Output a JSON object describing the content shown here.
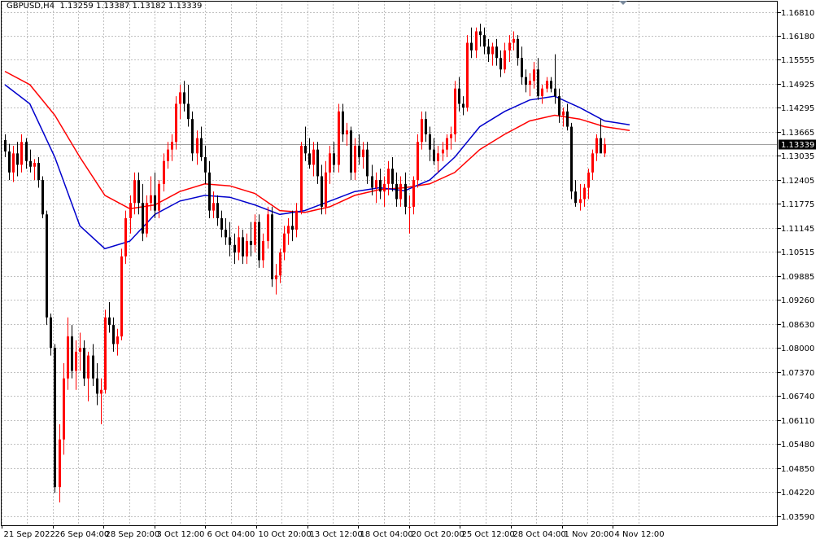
{
  "header": {
    "symbol": "GBPUSD,H4",
    "ohlc": "1.13259 1.13387 1.13182 1.13339"
  },
  "colors": {
    "bull": "#ff0000",
    "bear": "#000000",
    "ma_fast": "#0000cc",
    "ma_slow": "#ff0000",
    "grid": "#c0c0c0",
    "price_box": "#000000"
  },
  "chart_data": {
    "type": "candlestick",
    "ylim": [
      1.0335,
      1.171
    ],
    "grid": true,
    "current_price": "1.13339",
    "price_ticks": [
      "1.16810",
      "1.16180",
      "1.15555",
      "1.14925",
      "1.14295",
      "1.13665",
      "1.13035",
      "1.12405",
      "1.11775",
      "1.11145",
      "1.10515",
      "1.09885",
      "1.09260",
      "1.08630",
      "1.08000",
      "1.07370",
      "1.06740",
      "1.06110",
      "1.05480",
      "1.04850",
      "1.04220",
      "1.03590"
    ],
    "time_labels": [
      "21 Sep 2022",
      "26 Sep 04:00",
      "28 Sep 20:00",
      "3 Oct 12:00",
      "6 Oct 04:00",
      "10 Oct 20:00",
      "13 Oct 12:00",
      "18 Oct 04:00",
      "20 Oct 20:00",
      "25 Oct 12:00",
      "28 Oct 04:00",
      "1 Nov 20:00",
      "4 Nov 12:00"
    ],
    "candles": [
      [
        1.1345,
        1.136,
        1.13,
        1.1315
      ],
      [
        1.1315,
        1.1335,
        1.124,
        1.126
      ],
      [
        1.126,
        1.133,
        1.1235,
        1.131
      ],
      [
        1.131,
        1.134,
        1.125,
        1.128
      ],
      [
        1.128,
        1.136,
        1.126,
        1.134
      ],
      [
        1.134,
        1.135,
        1.127,
        1.129
      ],
      [
        1.129,
        1.132,
        1.126,
        1.1275
      ],
      [
        1.1275,
        1.1295,
        1.124,
        1.1285
      ],
      [
        1.1285,
        1.13,
        1.122,
        1.124
      ],
      [
        1.124,
        1.125,
        1.114,
        1.115
      ],
      [
        1.115,
        1.116,
        1.086,
        1.088
      ],
      [
        1.088,
        1.089,
        1.078,
        1.08
      ],
      [
        1.08,
        1.081,
        1.042,
        1.0435
      ],
      [
        1.0435,
        1.06,
        1.0395,
        1.056
      ],
      [
        1.056,
        1.076,
        1.052,
        1.072
      ],
      [
        1.072,
        1.088,
        1.069,
        1.083
      ],
      [
        1.083,
        1.086,
        1.072,
        1.074
      ],
      [
        1.074,
        1.082,
        1.069,
        1.079
      ],
      [
        1.079,
        1.084,
        1.074,
        1.08
      ],
      [
        1.08,
        1.082,
        1.07,
        1.072
      ],
      [
        1.072,
        1.079,
        1.066,
        1.078
      ],
      [
        1.078,
        1.081,
        1.07,
        1.072
      ],
      [
        1.072,
        1.076,
        1.065,
        1.068
      ],
      [
        1.068,
        1.072,
        1.06,
        1.069
      ],
      [
        1.069,
        1.09,
        1.068,
        1.088
      ],
      [
        1.088,
        1.092,
        1.084,
        1.086
      ],
      [
        1.086,
        1.088,
        1.079,
        1.081
      ],
      [
        1.081,
        1.085,
        1.078,
        1.083
      ],
      [
        1.083,
        1.106,
        1.082,
        1.104
      ],
      [
        1.104,
        1.116,
        1.102,
        1.114
      ],
      [
        1.114,
        1.12,
        1.11,
        1.118
      ],
      [
        1.118,
        1.126,
        1.115,
        1.124
      ],
      [
        1.124,
        1.126,
        1.115,
        1.118
      ],
      [
        1.118,
        1.123,
        1.108,
        1.11
      ],
      [
        1.11,
        1.12,
        1.109,
        1.118
      ],
      [
        1.118,
        1.125,
        1.116,
        1.12
      ],
      [
        1.12,
        1.126,
        1.114,
        1.116
      ],
      [
        1.116,
        1.124,
        1.114,
        1.123
      ],
      [
        1.123,
        1.131,
        1.121,
        1.129
      ],
      [
        1.129,
        1.134,
        1.127,
        1.132
      ],
      [
        1.132,
        1.136,
        1.129,
        1.134
      ],
      [
        1.134,
        1.146,
        1.132,
        1.144
      ],
      [
        1.144,
        1.149,
        1.14,
        1.147
      ],
      [
        1.147,
        1.15,
        1.142,
        1.144
      ],
      [
        1.144,
        1.149,
        1.138,
        1.14
      ],
      [
        1.14,
        1.142,
        1.129,
        1.131
      ],
      [
        1.131,
        1.137,
        1.128,
        1.135
      ],
      [
        1.135,
        1.138,
        1.129,
        1.13
      ],
      [
        1.13,
        1.133,
        1.123,
        1.126
      ],
      [
        1.126,
        1.129,
        1.114,
        1.116
      ],
      [
        1.116,
        1.121,
        1.114,
        1.118
      ],
      [
        1.118,
        1.12,
        1.112,
        1.114
      ],
      [
        1.114,
        1.116,
        1.109,
        1.111
      ],
      [
        1.111,
        1.114,
        1.107,
        1.109
      ],
      [
        1.109,
        1.113,
        1.104,
        1.107
      ],
      [
        1.107,
        1.11,
        1.102,
        1.105
      ],
      [
        1.105,
        1.112,
        1.103,
        1.109
      ],
      [
        1.109,
        1.111,
        1.102,
        1.104
      ],
      [
        1.104,
        1.11,
        1.102,
        1.108
      ],
      [
        1.108,
        1.113,
        1.104,
        1.107
      ],
      [
        1.107,
        1.115,
        1.105,
        1.113
      ],
      [
        1.113,
        1.115,
        1.101,
        1.103
      ],
      [
        1.103,
        1.11,
        1.101,
        1.108
      ],
      [
        1.108,
        1.117,
        1.106,
        1.115
      ],
      [
        1.115,
        1.117,
        1.096,
        1.098
      ],
      [
        1.098,
        1.102,
        1.094,
        1.099
      ],
      [
        1.099,
        1.106,
        1.097,
        1.105
      ],
      [
        1.105,
        1.112,
        1.103,
        1.11
      ],
      [
        1.11,
        1.114,
        1.107,
        1.112
      ],
      [
        1.112,
        1.116,
        1.108,
        1.111
      ],
      [
        1.111,
        1.118,
        1.109,
        1.116
      ],
      [
        1.116,
        1.134,
        1.115,
        1.133
      ],
      [
        1.133,
        1.138,
        1.129,
        1.131
      ],
      [
        1.131,
        1.135,
        1.127,
        1.128
      ],
      [
        1.128,
        1.134,
        1.125,
        1.132
      ],
      [
        1.132,
        1.134,
        1.123,
        1.125
      ],
      [
        1.125,
        1.128,
        1.115,
        1.117
      ],
      [
        1.117,
        1.129,
        1.115,
        1.126
      ],
      [
        1.126,
        1.133,
        1.123,
        1.131
      ],
      [
        1.131,
        1.134,
        1.126,
        1.128
      ],
      [
        1.128,
        1.144,
        1.126,
        1.142
      ],
      [
        1.142,
        1.144,
        1.134,
        1.136
      ],
      [
        1.136,
        1.139,
        1.133,
        1.137
      ],
      [
        1.137,
        1.138,
        1.124,
        1.126
      ],
      [
        1.126,
        1.135,
        1.124,
        1.133
      ],
      [
        1.133,
        1.136,
        1.128,
        1.13
      ],
      [
        1.13,
        1.134,
        1.127,
        1.132
      ],
      [
        1.132,
        1.134,
        1.123,
        1.125
      ],
      [
        1.125,
        1.128,
        1.12,
        1.122
      ],
      [
        1.122,
        1.126,
        1.118,
        1.124
      ],
      [
        1.124,
        1.127,
        1.119,
        1.121
      ],
      [
        1.121,
        1.125,
        1.117,
        1.123
      ],
      [
        1.123,
        1.129,
        1.12,
        1.127
      ],
      [
        1.127,
        1.13,
        1.121,
        1.123
      ],
      [
        1.123,
        1.126,
        1.117,
        1.119
      ],
      [
        1.119,
        1.125,
        1.117,
        1.123
      ],
      [
        1.123,
        1.126,
        1.115,
        1.117
      ],
      [
        1.117,
        1.12,
        1.11,
        1.117
      ],
      [
        1.117,
        1.125,
        1.115,
        1.124
      ],
      [
        1.124,
        1.136,
        1.122,
        1.134
      ],
      [
        1.134,
        1.142,
        1.132,
        1.14
      ],
      [
        1.14,
        1.142,
        1.134,
        1.136
      ],
      [
        1.136,
        1.138,
        1.129,
        1.132
      ],
      [
        1.132,
        1.135,
        1.128,
        1.129
      ],
      [
        1.129,
        1.133,
        1.126,
        1.131
      ],
      [
        1.131,
        1.134,
        1.129,
        1.132
      ],
      [
        1.132,
        1.136,
        1.13,
        1.135
      ],
      [
        1.135,
        1.138,
        1.132,
        1.136
      ],
      [
        1.136,
        1.15,
        1.134,
        1.148
      ],
      [
        1.148,
        1.151,
        1.142,
        1.144
      ],
      [
        1.144,
        1.146,
        1.141,
        1.143
      ],
      [
        1.143,
        1.162,
        1.142,
        1.16
      ],
      [
        1.16,
        1.164,
        1.156,
        1.158
      ],
      [
        1.158,
        1.164,
        1.156,
        1.163
      ],
      [
        1.163,
        1.165,
        1.159,
        1.162
      ],
      [
        1.162,
        1.164,
        1.157,
        1.159
      ],
      [
        1.159,
        1.161,
        1.155,
        1.157
      ],
      [
        1.157,
        1.16,
        1.154,
        1.159
      ],
      [
        1.159,
        1.161,
        1.154,
        1.156
      ],
      [
        1.156,
        1.158,
        1.151,
        1.153
      ],
      [
        1.153,
        1.16,
        1.152,
        1.158
      ],
      [
        1.158,
        1.162,
        1.155,
        1.16
      ],
      [
        1.16,
        1.163,
        1.158,
        1.161
      ],
      [
        1.161,
        1.162,
        1.154,
        1.156
      ],
      [
        1.156,
        1.159,
        1.149,
        1.151
      ],
      [
        1.151,
        1.153,
        1.147,
        1.149
      ],
      [
        1.149,
        1.152,
        1.146,
        1.15
      ],
      [
        1.15,
        1.155,
        1.148,
        1.153
      ],
      [
        1.153,
        1.156,
        1.145,
        1.146
      ],
      [
        1.146,
        1.149,
        1.144,
        1.148
      ],
      [
        1.148,
        1.151,
        1.147,
        1.15
      ],
      [
        1.15,
        1.151,
        1.147,
        1.148
      ],
      [
        1.148,
        1.157,
        1.144,
        1.146
      ],
      [
        1.146,
        1.148,
        1.139,
        1.141
      ],
      [
        1.141,
        1.143,
        1.138,
        1.142
      ],
      [
        1.142,
        1.144,
        1.137,
        1.138
      ],
      [
        1.138,
        1.139,
        1.119,
        1.121
      ],
      [
        1.121,
        1.124,
        1.117,
        1.118
      ],
      [
        1.118,
        1.123,
        1.116,
        1.119
      ],
      [
        1.119,
        1.123,
        1.117,
        1.122
      ],
      [
        1.122,
        1.127,
        1.119,
        1.126
      ],
      [
        1.126,
        1.132,
        1.124,
        1.131
      ],
      [
        1.131,
        1.136,
        1.129,
        1.135
      ],
      [
        1.135,
        1.14,
        1.132,
        1.131
      ],
      [
        1.131,
        1.135,
        1.13,
        1.1334
      ]
    ],
    "ma_fast": [
      {
        "i": 0,
        "v": 1.149
      },
      {
        "i": 6,
        "v": 1.144
      },
      {
        "i": 12,
        "v": 1.13
      },
      {
        "i": 18,
        "v": 1.112
      },
      {
        "i": 24,
        "v": 1.106
      },
      {
        "i": 30,
        "v": 1.108
      },
      {
        "i": 36,
        "v": 1.115
      },
      {
        "i": 42,
        "v": 1.1185
      },
      {
        "i": 48,
        "v": 1.12
      },
      {
        "i": 54,
        "v": 1.1195
      },
      {
        "i": 60,
        "v": 1.1175
      },
      {
        "i": 66,
        "v": 1.115
      },
      {
        "i": 72,
        "v": 1.116
      },
      {
        "i": 78,
        "v": 1.1185
      },
      {
        "i": 84,
        "v": 1.121
      },
      {
        "i": 90,
        "v": 1.122
      },
      {
        "i": 96,
        "v": 1.1212
      },
      {
        "i": 102,
        "v": 1.124
      },
      {
        "i": 108,
        "v": 1.13
      },
      {
        "i": 114,
        "v": 1.138
      },
      {
        "i": 120,
        "v": 1.142
      },
      {
        "i": 126,
        "v": 1.145
      },
      {
        "i": 132,
        "v": 1.146
      },
      {
        "i": 138,
        "v": 1.143
      },
      {
        "i": 144,
        "v": 1.1395
      },
      {
        "i": 150,
        "v": 1.1385
      }
    ],
    "ma_slow": [
      {
        "i": 0,
        "v": 1.1525
      },
      {
        "i": 6,
        "v": 1.149
      },
      {
        "i": 12,
        "v": 1.141
      },
      {
        "i": 18,
        "v": 1.13
      },
      {
        "i": 24,
        "v": 1.12
      },
      {
        "i": 30,
        "v": 1.1165
      },
      {
        "i": 36,
        "v": 1.1175
      },
      {
        "i": 42,
        "v": 1.121
      },
      {
        "i": 48,
        "v": 1.123
      },
      {
        "i": 54,
        "v": 1.1225
      },
      {
        "i": 60,
        "v": 1.1205
      },
      {
        "i": 66,
        "v": 1.116
      },
      {
        "i": 72,
        "v": 1.1155
      },
      {
        "i": 78,
        "v": 1.117
      },
      {
        "i": 84,
        "v": 1.12
      },
      {
        "i": 90,
        "v": 1.1215
      },
      {
        "i": 96,
        "v": 1.122
      },
      {
        "i": 102,
        "v": 1.123
      },
      {
        "i": 108,
        "v": 1.126
      },
      {
        "i": 114,
        "v": 1.132
      },
      {
        "i": 120,
        "v": 1.136
      },
      {
        "i": 126,
        "v": 1.1395
      },
      {
        "i": 132,
        "v": 1.141
      },
      {
        "i": 138,
        "v": 1.14
      },
      {
        "i": 144,
        "v": 1.138
      },
      {
        "i": 150,
        "v": 1.137
      }
    ]
  }
}
